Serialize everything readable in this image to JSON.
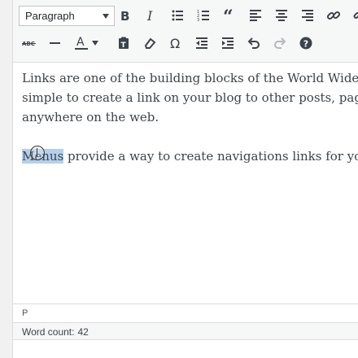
{
  "toolbar": {
    "format_select": {
      "value": "Paragraph"
    },
    "row1_icons": [
      "bold-icon",
      "italic-icon",
      "bullet-list-icon",
      "numbered-list-icon",
      "blockquote-icon",
      "align-left-icon",
      "align-center-icon",
      "align-right-icon",
      "insert-link-icon"
    ],
    "row2_icons": [
      "strikethrough-icon",
      "horizontal-line-icon",
      "text-color-icon",
      "paste-as-text-icon",
      "clear-formatting-icon",
      "special-character-icon",
      "outdent-icon",
      "indent-icon",
      "undo-icon",
      "redo-icon",
      "help-icon"
    ]
  },
  "content": {
    "paragraph1_line1": "Links are one of the building blocks of the World Wide Web. It is",
    "paragraph1_line2": "simple to create a link on your blog to other posts, pages or",
    "paragraph1_line3": "anywhere on the web.",
    "paragraph2_selected": "Menus",
    "paragraph2_rest": " provide a way to create navigations links for your site."
  },
  "statusbar": {
    "path": "P",
    "word_count_label": "Word count:",
    "word_count_value": "42"
  },
  "colors": {
    "selection": "#b4d0ec",
    "toolbar_bg": "#f6f7f7",
    "icon": "#3c434a"
  }
}
